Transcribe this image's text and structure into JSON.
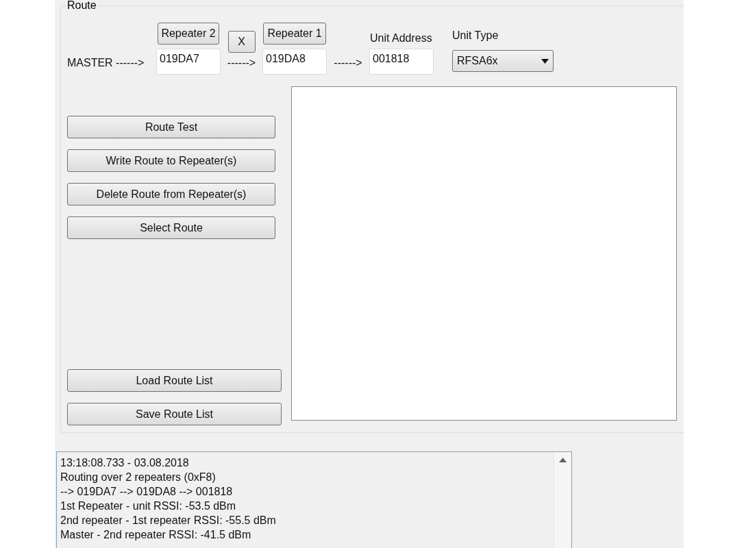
{
  "group": {
    "title": "Route"
  },
  "route": {
    "source": "MASTER ------>",
    "repeater_2": {
      "button": "Repeater 2",
      "address": "019DA7"
    },
    "remove_button": "X",
    "arrow_1": "------>",
    "repeater_1": {
      "button": "Repeater 1",
      "address": "019DA8"
    },
    "arrow_2": "------>",
    "unit_address": {
      "label": "Unit Address",
      "value": "001818"
    },
    "unit_type": {
      "label": "Unit Type",
      "value": "RFSA6x"
    }
  },
  "actions": [
    {
      "label": "Route Test",
      "kind": "top"
    },
    {
      "label": "Write Route to Repeater(s)",
      "kind": "top"
    },
    {
      "label": "Delete Route from Repeater(s)",
      "kind": "top"
    },
    {
      "label": "Select Route",
      "kind": "top"
    },
    {
      "label": "Load Route List",
      "kind": "bottom"
    },
    {
      "label": "Save Route List",
      "kind": "bottom"
    }
  ],
  "log": {
    "lines": [
      "13:18:08.733 - 03.08.2018",
      "Routing over 2 repeaters (0xF8)",
      "--> 019DA7 --> 019DA8 --> 001818",
      "1st Repeater - unit RSSI: -53.5 dBm",
      "2nd repeater - 1st repeater RSSI: -55.5 dBm",
      "Master - 2nd repeater RSSI: -41.5 dBm"
    ]
  }
}
